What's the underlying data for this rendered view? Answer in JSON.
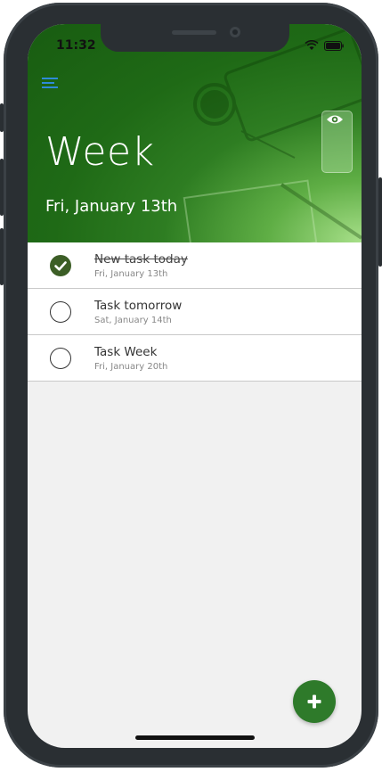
{
  "status": {
    "time": "11:32"
  },
  "header": {
    "title": "Week",
    "date": "Fri, January 13th"
  },
  "tasks": [
    {
      "title": "New task today",
      "date": "Fri, January 13th",
      "done": true
    },
    {
      "title": "Task tomorrow",
      "date": "Sat, January 14th",
      "done": false
    },
    {
      "title": "Task Week",
      "date": "Fri, January 20th",
      "done": false
    }
  ],
  "icons": {
    "menu": "menu-icon",
    "eye": "eye-icon",
    "check": "checkmark-icon",
    "add": "plus-icon",
    "wifi": "wifi-icon",
    "battery": "battery-icon"
  },
  "colors": {
    "accent": "#2e7a2a",
    "done_check": "#3c5e26",
    "menu_blue": "#2e8bd8"
  }
}
